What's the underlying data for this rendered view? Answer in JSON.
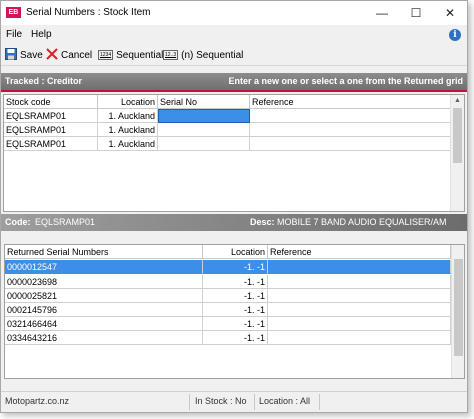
{
  "window": {
    "app_icon_text": "EB",
    "title": "Serial Numbers : Stock Item",
    "minimize": "—",
    "maximize": "☐",
    "close": "✕"
  },
  "menu": {
    "file": "File",
    "help": "Help",
    "info": "i"
  },
  "toolbar": {
    "save": "Save",
    "cancel": "Cancel",
    "sequential": "Sequential",
    "n_sequential": "(n) Sequential",
    "seq_icon": "1234",
    "nseq_icon": "12..3"
  },
  "tracked_header": {
    "left": "Tracked : Creditor",
    "right": "Enter a new one or select a one from the Returned grid"
  },
  "top_grid": {
    "columns": [
      "Stock code",
      "Location",
      "Serial No",
      "Reference"
    ],
    "rows": [
      {
        "stock_code": "EQLSRAMP01",
        "location": "1. Auckland",
        "serial_no": "",
        "reference": ""
      },
      {
        "stock_code": "EQLSRAMP01",
        "location": "1. Auckland",
        "serial_no": "",
        "reference": ""
      },
      {
        "stock_code": "EQLSRAMP01",
        "location": "1. Auckland",
        "serial_no": "",
        "reference": ""
      }
    ]
  },
  "code_header": {
    "code_label": "Code:",
    "code_value": "EQLSRAMP01",
    "desc_label": "Desc:",
    "desc_value": "MOBILE 7 BAND AUDIO EQUALISER/AM"
  },
  "returned_grid": {
    "columns": [
      "Returned Serial Numbers",
      "Location",
      "Reference"
    ],
    "rows": [
      {
        "serial": "0000012547",
        "location": "-1. -1",
        "reference": ""
      },
      {
        "serial": "0000023698",
        "location": "-1. -1",
        "reference": ""
      },
      {
        "serial": "0000025821",
        "location": "-1. -1",
        "reference": ""
      },
      {
        "serial": "0002145796",
        "location": "-1. -1",
        "reference": ""
      },
      {
        "serial": "0321466464",
        "location": "-1. -1",
        "reference": ""
      },
      {
        "serial": "0334643216",
        "location": "-1. -1",
        "reference": ""
      }
    ]
  },
  "status": {
    "site": "Motopartz.co.nz",
    "in_stock": "In Stock : No",
    "location": "Location : All"
  }
}
